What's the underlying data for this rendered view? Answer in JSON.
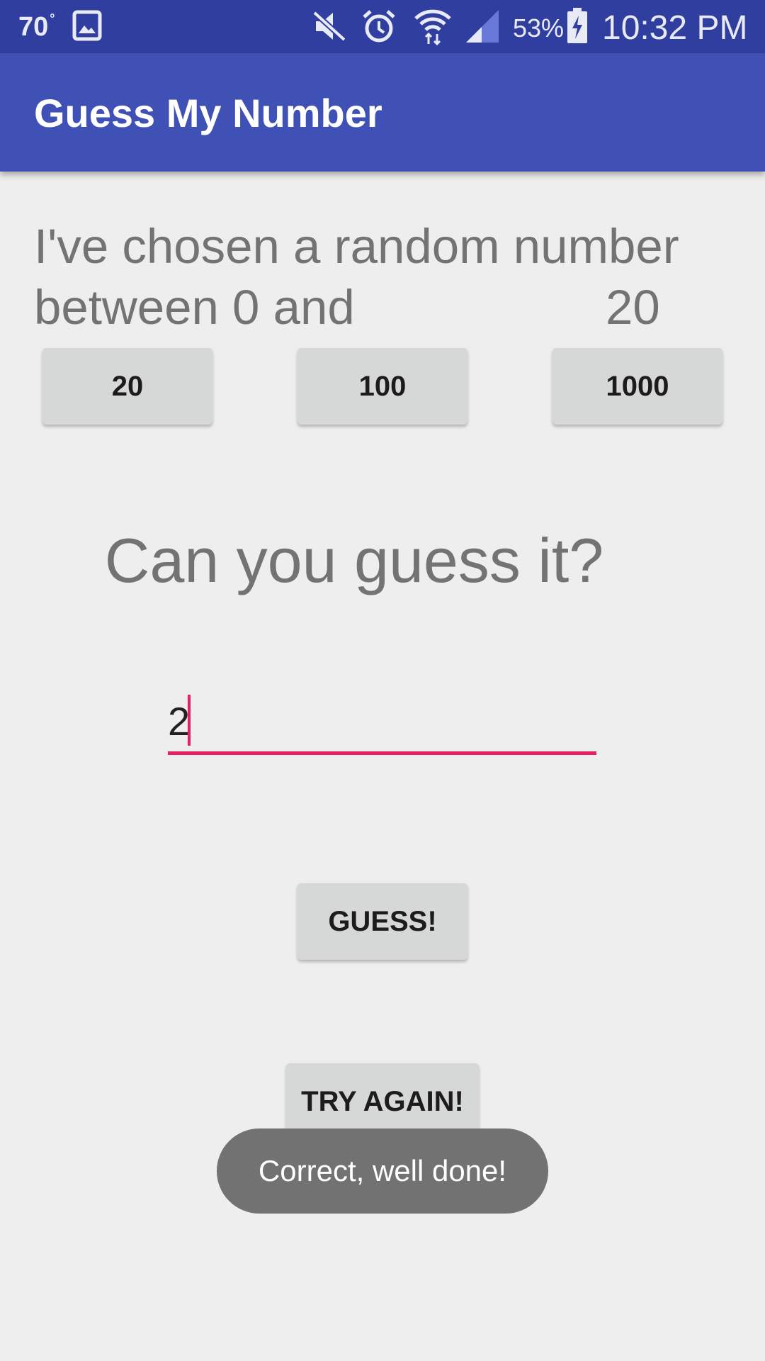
{
  "status_bar": {
    "temperature": "70",
    "degree_symbol": "°",
    "battery_percent": "53%",
    "time": "10:32 PM",
    "icons": [
      "image-notification-icon",
      "mute-icon",
      "alarm-icon",
      "wifi-icon",
      "signal-icon",
      "battery-charging-icon"
    ]
  },
  "app_bar": {
    "title": "Guess My Number"
  },
  "intro": {
    "text": "I've chosen a random number between 0 and",
    "max_value": "20"
  },
  "range_buttons": [
    {
      "label": "20"
    },
    {
      "label": "100"
    },
    {
      "label": "1000"
    }
  ],
  "prompt": "Can you guess it?",
  "guess_input": {
    "value": "2"
  },
  "guess_button": {
    "label": "GUESS!"
  },
  "try_again_button": {
    "label": "TRY AGAIN!"
  },
  "toast": {
    "message": "Correct, well done!"
  },
  "colors": {
    "primary": "#3f51b5",
    "primary_dark": "#303f9f",
    "accent": "#e91e63",
    "background": "#eeeeee"
  }
}
